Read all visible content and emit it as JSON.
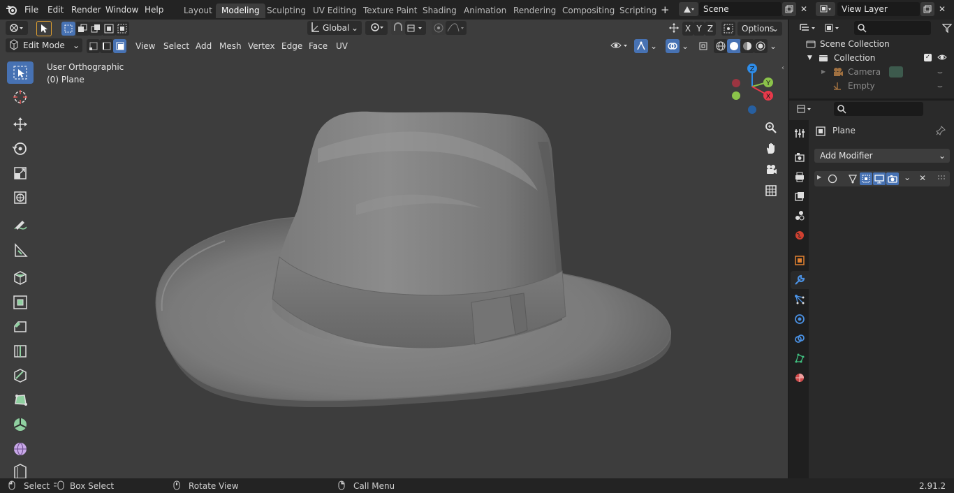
{
  "menubar": {
    "items": [
      "File",
      "Edit",
      "Render",
      "Window",
      "Help"
    ],
    "workspaces": [
      "Layout",
      "Modeling",
      "Sculpting",
      "UV Editing",
      "Texture Paint",
      "Shading",
      "Animation",
      "Rendering",
      "Compositing",
      "Scripting"
    ],
    "active_workspace": "Modeling",
    "add_workspace": "+",
    "scene": "Scene",
    "view_layer": "View Layer"
  },
  "viewport": {
    "orientation": "Global",
    "options_label": "Options",
    "mode": "Edit Mode",
    "menus": [
      "View",
      "Select",
      "Add",
      "Mesh",
      "Vertex",
      "Edge",
      "Face",
      "UV"
    ],
    "view_name": "User Orthographic",
    "object_label": "(0) Plane",
    "axis_lock": [
      "X",
      "Y",
      "Z"
    ],
    "gizmo": {
      "x": "X",
      "y": "Y",
      "z": "Z"
    }
  },
  "outliner": {
    "scene_collection": "Scene Collection",
    "collection": "Collection",
    "objects": [
      "Camera",
      "Empty"
    ]
  },
  "properties": {
    "object_name": "Plane",
    "add_modifier": "Add Modifier"
  },
  "statusbar": {
    "select": "Select",
    "box_select": "Box Select",
    "rotate_view": "Rotate View",
    "call_menu": "Call Menu",
    "version": "2.91.2"
  },
  "colors": {
    "accent": "#4772b3",
    "viewport_bg": "#3d3d3d",
    "axis_x": "#e8394a",
    "axis_y": "#8bc34a",
    "axis_z": "#2e8dea"
  }
}
